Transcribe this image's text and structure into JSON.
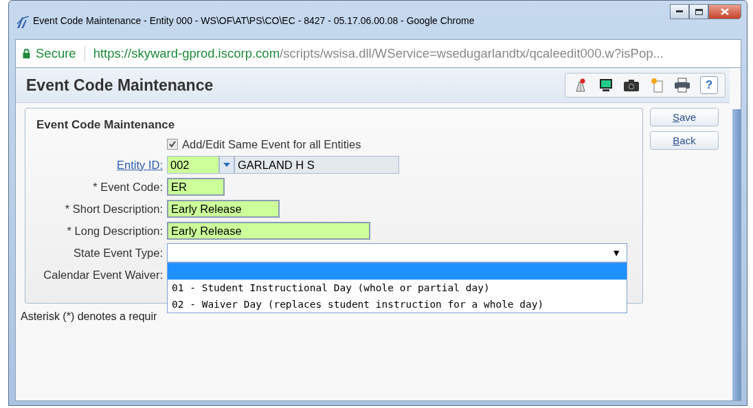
{
  "window": {
    "title": "Event Code Maintenance - Entity 000 - WS\\OF\\AT\\PS\\CO\\EC - 8427 - 05.17.06.00.08 - Google Chrome"
  },
  "address_bar": {
    "security": "Secure",
    "host": "https://skyward-gprod.iscorp.com",
    "path": "/scripts/wsisa.dll/WService=wsedugarlandtx/qcaleedit000.w?isPop..."
  },
  "page": {
    "title": "Event Code Maintenance"
  },
  "toolbar": [
    {
      "kind": "map"
    },
    {
      "kind": "monitor"
    },
    {
      "kind": "camera"
    },
    {
      "kind": "note"
    },
    {
      "kind": "print"
    },
    {
      "kind": "help",
      "label": "?"
    }
  ],
  "form": {
    "title": "Event Code Maintenance",
    "all_entities": {
      "label": "Add/Edit Same Event for all Entities",
      "checked": true
    },
    "fields": [
      {
        "kind": "entity",
        "label": "Entity ID:",
        "value": "002",
        "name": "GARLAND H S"
      },
      {
        "kind": "text",
        "label": "* Event Code:",
        "value": "ER"
      },
      {
        "kind": "text",
        "label": "* Short Description:",
        "value": "Early Release"
      },
      {
        "kind": "text",
        "label": "* Long Description:",
        "value": "Early Release"
      },
      {
        "kind": "select",
        "label": "State Event Type:",
        "expanded": true,
        "arrow": "▼",
        "options": [
          {
            "selected": true
          },
          {
            "label": "01 - Student Instructional Day (whole or partial day)",
            "selected": false
          },
          {
            "label": "02 - Waiver Day (replaces student instruction for a whole day)",
            "selected": false
          }
        ]
      },
      {
        "kind": "label_only",
        "label": "Calendar Event Waiver:"
      }
    ]
  },
  "buttons": [
    "Save",
    "Back"
  ],
  "footnote": "Asterisk (*) denotes a requir"
}
